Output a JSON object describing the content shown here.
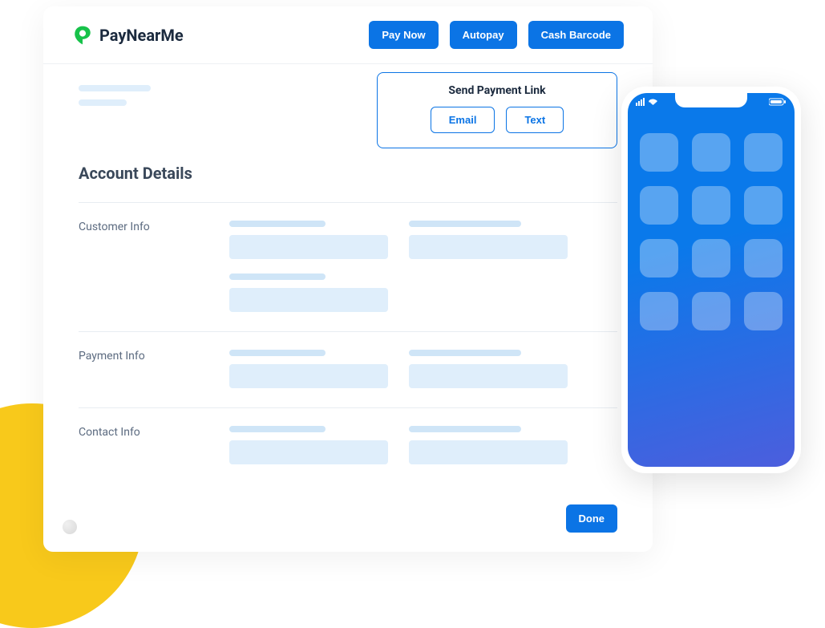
{
  "brand": "PayNearMe",
  "header_buttons": {
    "pay_now": "Pay Now",
    "autopay": "Autopay",
    "cash_barcode": "Cash Barcode"
  },
  "send_link": {
    "title": "Send Payment Link",
    "email": "Email",
    "text": "Text"
  },
  "account_details_heading": "Account Details",
  "sections": {
    "customer": "Customer Info",
    "payment": "Payment Info",
    "contact": "Contact Info"
  },
  "done": "Done"
}
